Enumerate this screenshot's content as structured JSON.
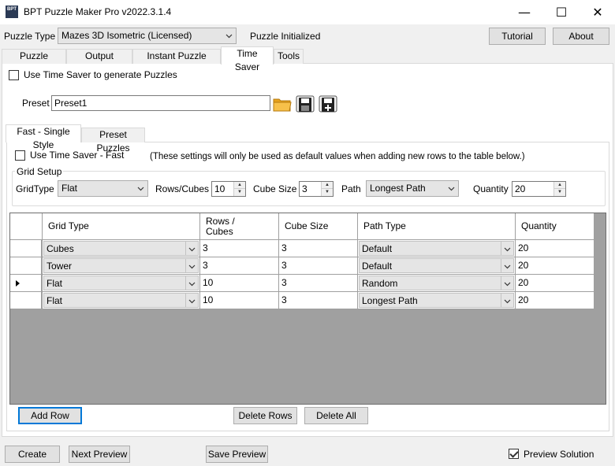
{
  "window": {
    "title": "BPT Puzzle Maker Pro v2022.3.1.4",
    "icon_text": "BPT",
    "minimize_glyph": "—",
    "maximize_glyph": "☐",
    "close_glyph": "✕"
  },
  "top": {
    "puzzle_type_label": "Puzzle Type",
    "puzzle_type_value": "Mazes 3D Isometric (Licensed)",
    "status_text": "Puzzle Initialized",
    "tutorial_label": "Tutorial",
    "about_label": "About"
  },
  "tabs": [
    {
      "label": "Puzzle Settings"
    },
    {
      "label": "Output Settings"
    },
    {
      "label": "Instant Puzzle Books"
    },
    {
      "label": "Time Saver"
    },
    {
      "label": "Tools"
    }
  ],
  "time_saver": {
    "use_checkbox_label": "Use Time Saver to generate Puzzles",
    "use_checked": false,
    "preset_label": "Preset",
    "preset_value": "Preset1"
  },
  "inner_tabs": [
    {
      "label": "Fast - Single Style"
    },
    {
      "label": "Preset Puzzles"
    }
  ],
  "fast": {
    "use_fast_label": "Use Time Saver - Fast",
    "use_fast_checked": false,
    "note": "(These settings will only be used as default values when adding new rows to the table below.)",
    "group_title": "Grid Setup",
    "gridtype_label": "GridType",
    "gridtype_value": "Flat",
    "rows_label": "Rows/Cubes",
    "rows_value": "10",
    "cube_size_label": "Cube Size",
    "cube_size_value": "3",
    "path_label": "Path",
    "path_value": "Longest Path",
    "quantity_label": "Quantity",
    "quantity_value": "20"
  },
  "grid": {
    "columns": [
      "Grid Type",
      "Rows / Cubes",
      "Cube Size",
      "Path Type",
      "Quantity"
    ],
    "rows": [
      {
        "grid_type": "Cubes",
        "rows": "3",
        "cube_size": "3",
        "path_type": "Default",
        "quantity": "20",
        "current": false
      },
      {
        "grid_type": "Tower",
        "rows": "3",
        "cube_size": "3",
        "path_type": "Default",
        "quantity": "20",
        "current": false
      },
      {
        "grid_type": "Flat",
        "rows": "10",
        "cube_size": "3",
        "path_type": "Random",
        "quantity": "20",
        "current": true
      },
      {
        "grid_type": "Flat",
        "rows": "10",
        "cube_size": "3",
        "path_type": "Longest Path",
        "quantity": "20",
        "current": false
      }
    ]
  },
  "grid_buttons": {
    "add_row": "Add Row",
    "delete_rows": "Delete Rows",
    "delete_all": "Delete All"
  },
  "bottom": {
    "create": "Create",
    "next_preview": "Next Preview",
    "save_preview": "Save Preview",
    "preview_solution_label": "Preview Solution",
    "preview_solution_checked": true
  },
  "colors": {
    "accent": "#0078d7",
    "folder": "#f5a623",
    "grid_bg": "#a0a0a0"
  }
}
